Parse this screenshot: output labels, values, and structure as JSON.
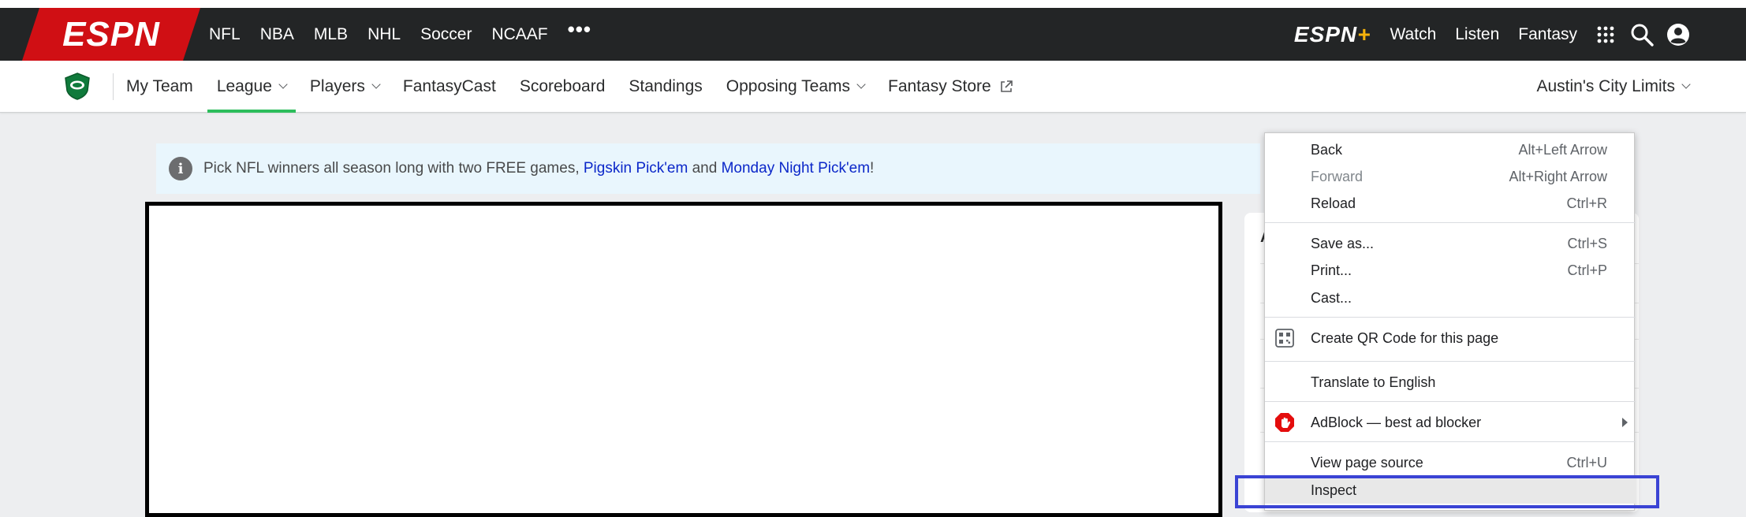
{
  "topnav": {
    "logo": "ESPN",
    "sports": [
      "NFL",
      "NBA",
      "MLB",
      "NHL",
      "Soccer",
      "NCAAF"
    ],
    "more": "•••",
    "espn_plus": "ESPN",
    "espn_plus_mark": "+",
    "links": [
      "Watch",
      "Listen",
      "Fantasy"
    ],
    "icons": [
      "apps-grid-icon",
      "search-icon",
      "profile-icon"
    ]
  },
  "subnav": {
    "items": [
      {
        "label": "My Team"
      },
      {
        "label": "League"
      },
      {
        "label": "Players"
      },
      {
        "label": "FantasyCast"
      },
      {
        "label": "Scoreboard"
      },
      {
        "label": "Standings"
      },
      {
        "label": "Opposing Teams"
      },
      {
        "label": "Fantasy Store"
      }
    ],
    "team": "Austin's City Limits"
  },
  "notice": {
    "text_before": "Pick NFL winners all season long with two FREE games, ",
    "link1": "Pigskin Pick'em",
    "middle": " and ",
    "link2": "Monday Night Pick'em",
    "after": "!"
  },
  "right_card": {
    "fragment": "A"
  },
  "context_menu": {
    "items": [
      {
        "label": "Back",
        "shortcut": "Alt+Left Arrow"
      },
      {
        "label": "Forward",
        "shortcut": "Alt+Right Arrow"
      },
      {
        "label": "Reload",
        "shortcut": "Ctrl+R"
      },
      {
        "label": "Save as...",
        "shortcut": "Ctrl+S"
      },
      {
        "label": "Print...",
        "shortcut": "Ctrl+P"
      },
      {
        "label": "Cast..."
      },
      {
        "label": "Create QR Code for this page"
      },
      {
        "label": "Translate to English"
      },
      {
        "label": "AdBlock — best ad blocker"
      },
      {
        "label": "View page source",
        "shortcut": "Ctrl+U"
      },
      {
        "label": "Inspect"
      }
    ]
  },
  "colors": {
    "espn_red": "#d00f14",
    "topbar": "#232526",
    "active_underline": "#2dbd5c",
    "link_blue": "#0b27c9",
    "focus_outline": "#3a43d4"
  }
}
